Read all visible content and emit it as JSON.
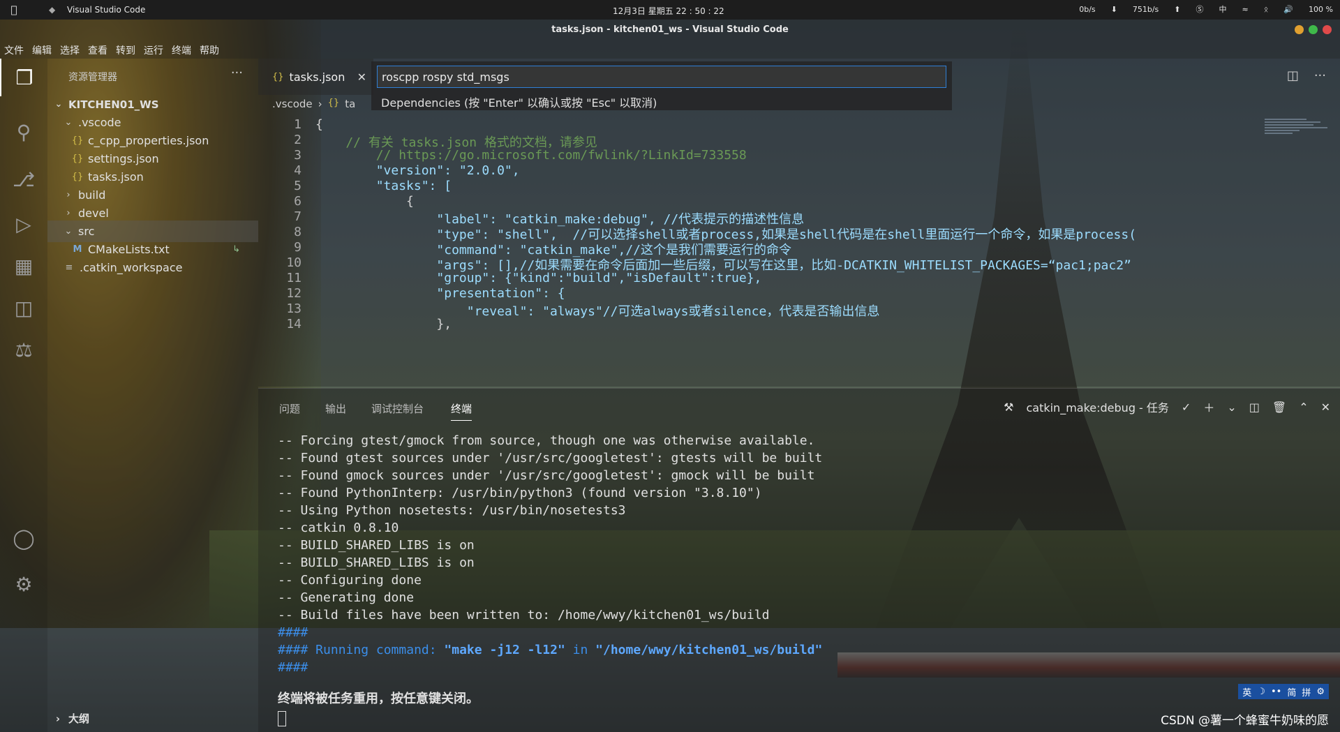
{
  "system_bar": {
    "app_name": "Visual Studio Code",
    "datetime": "12月3日 星期五 22 : 50 : 22",
    "net_down": "0b/s",
    "net_up": "751b/s",
    "input_method": "中",
    "battery": "100 %"
  },
  "window": {
    "title": "tasks.json - kitchen01_ws - Visual Studio Code"
  },
  "menu": [
    "文件",
    "编辑",
    "选择",
    "查看",
    "转到",
    "运行",
    "终端",
    "帮助"
  ],
  "sidebar": {
    "title": "资源管理器",
    "root": "KITCHEN01_WS",
    "items": [
      {
        "label": ".vscode",
        "icon": "chevron-down"
      },
      {
        "label": "c_cpp_properties.json",
        "icon": "json"
      },
      {
        "label": "settings.json",
        "icon": "json"
      },
      {
        "label": "tasks.json",
        "icon": "json"
      },
      {
        "label": "build",
        "icon": "chevron-right"
      },
      {
        "label": "devel",
        "icon": "chevron-right"
      },
      {
        "label": "src",
        "icon": "chevron-down"
      },
      {
        "label": "CMakeLists.txt",
        "icon": "cmake"
      },
      {
        "label": ".catkin_workspace",
        "icon": "plain"
      }
    ],
    "outline": "大纲"
  },
  "editor": {
    "tab_label": "tasks.json",
    "breadcrumb": [
      ".vscode",
      "ta"
    ],
    "quick_pick": {
      "value": "roscpp rospy std_msgs",
      "hint": "Dependencies (按 \"Enter\" 以确认或按 \"Esc\" 以取消)"
    },
    "lines": [
      {
        "n": "1",
        "text": "{"
      },
      {
        "n": "2",
        "text": "    // 有关 tasks.json 格式的文档，请参见"
      },
      {
        "n": "3",
        "text": "        // https://go.microsoft.com/fwlink/?LinkId=733558"
      },
      {
        "n": "4",
        "text": "        \"version\": \"2.0.0\","
      },
      {
        "n": "5",
        "text": "        \"tasks\": ["
      },
      {
        "n": "6",
        "text": "            {"
      },
      {
        "n": "7",
        "text": "                \"label\": \"catkin_make:debug\", //代表提示的描述性信息"
      },
      {
        "n": "8",
        "text": "                \"type\": \"shell\",  //可以选择shell或者process,如果是shell代码是在shell里面运行一个命令，如果是process("
      },
      {
        "n": "9",
        "text": "                \"command\": \"catkin_make\",//这个是我们需要运行的命令"
      },
      {
        "n": "10",
        "text": "                \"args\": [],//如果需要在命令后面加一些后缀，可以写在这里，比如-DCATKIN_WHITELIST_PACKAGES=“pac1;pac2”"
      },
      {
        "n": "11",
        "text": "                \"group\": {\"kind\":\"build\",\"isDefault\":true},"
      },
      {
        "n": "12",
        "text": "                \"presentation\": {"
      },
      {
        "n": "13",
        "text": "                    \"reveal\": \"always\"//可选always或者silence，代表是否输出信息"
      },
      {
        "n": "14",
        "text": "                },"
      }
    ]
  },
  "panel": {
    "tabs": [
      "问题",
      "输出",
      "调试控制台",
      "终端"
    ],
    "active_tab": "终端",
    "task_label": "catkin_make:debug - 任务",
    "terminal_lines": [
      "-- Forcing gtest/gmock from source, though one was otherwise available.",
      "-- Found gtest sources under '/usr/src/googletest': gtests will be built",
      "-- Found gmock sources under '/usr/src/googletest': gmock will be built",
      "-- Found PythonInterp: /usr/bin/python3 (found version \"3.8.10\")",
      "-- Using Python nosetests: /usr/bin/nosetests3",
      "-- catkin 0.8.10",
      "-- BUILD_SHARED_LIBS is on",
      "-- BUILD_SHARED_LIBS is on",
      "-- Configuring done",
      "-- Generating done",
      "-- Build files have been written to: /home/wwy/kitchen01_ws/build"
    ],
    "hash_line": "####",
    "running_prefix": "#### Running command: ",
    "running_cmd": "\"make -j12 -l12\"",
    "running_in": " in ",
    "running_path": "\"/home/wwy/kitchen01_ws/build\"",
    "closing_msg": "终端将被任务重用，按任意键关闭。"
  },
  "ime_bar": [
    "英",
    "☽",
    "••",
    "简",
    "拼",
    "⚙"
  ],
  "watermark": "CSDN @薯一个蜂蜜牛奶味的愿"
}
